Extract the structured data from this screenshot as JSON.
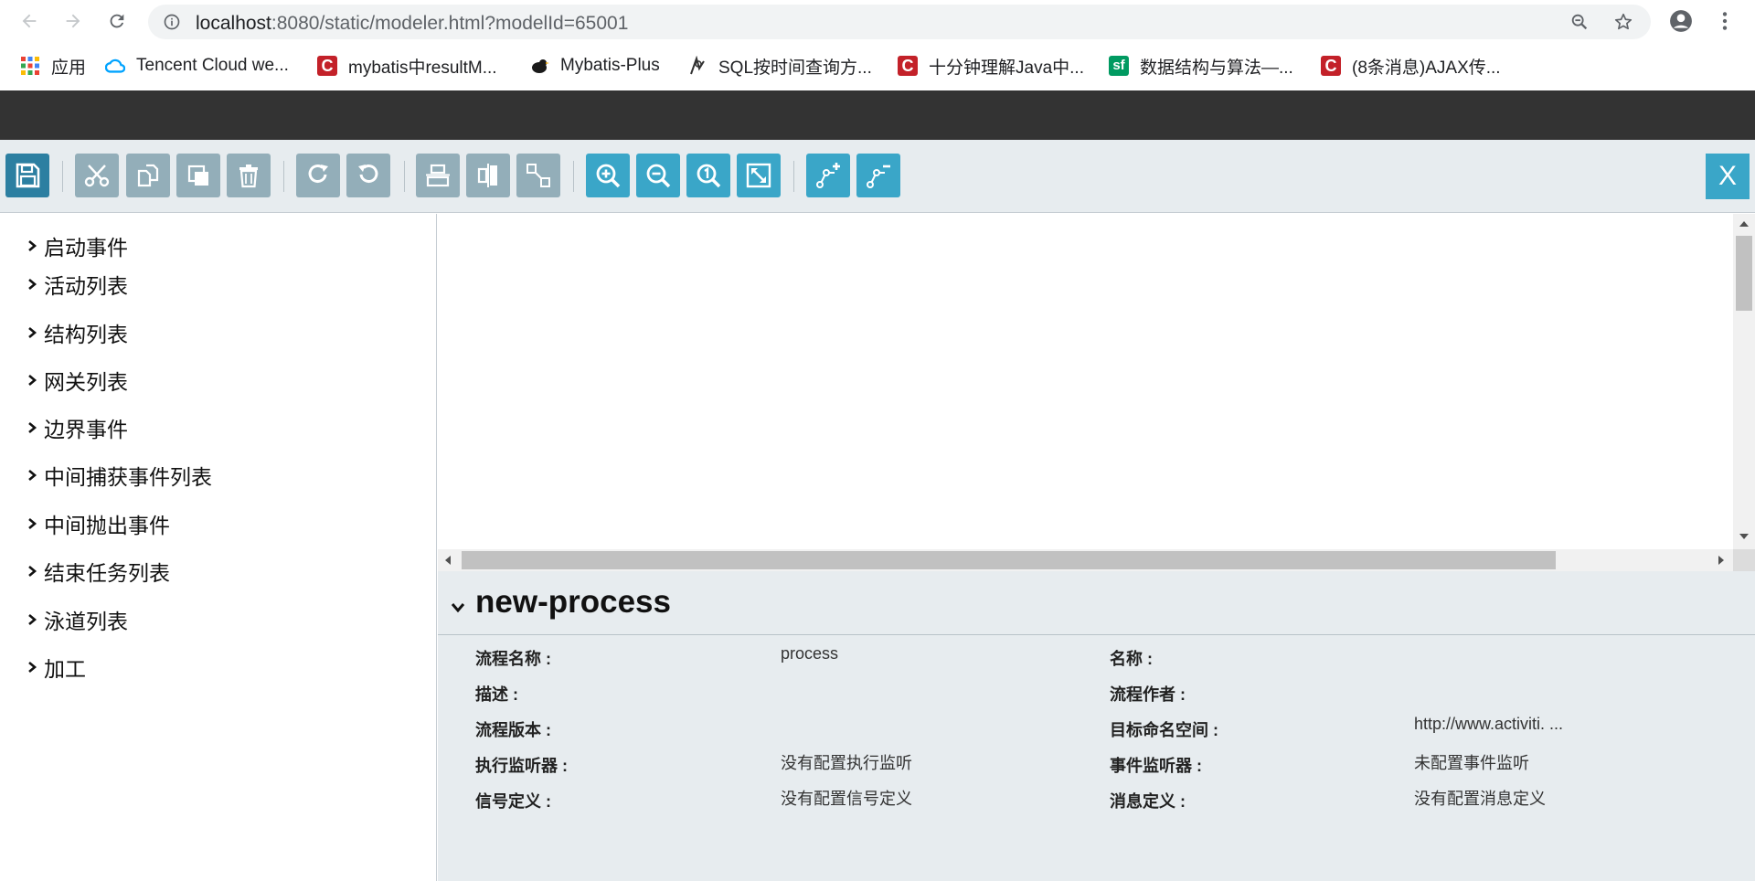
{
  "browser": {
    "url_host": "localhost",
    "url_rest": ":8080/static/modeler.html?modelId=65001"
  },
  "bookmarks": [
    {
      "label": "应用",
      "icon": "apps-grid-icon"
    },
    {
      "label": "Tencent Cloud we...",
      "icon": "tencent-cloud-icon"
    },
    {
      "label": "mybatis中resultM...",
      "icon": "csdn-icon"
    },
    {
      "label": "Mybatis-Plus",
      "icon": "mybatis-plus-bird-icon"
    },
    {
      "label": "SQL按时间查询方...",
      "icon": "sql-site-icon"
    },
    {
      "label": "十分钟理解Java中...",
      "icon": "csdn-icon"
    },
    {
      "label": "数据结构与算法—...",
      "icon": "segmentfault-icon"
    },
    {
      "label": "(8条消息)AJAX传...",
      "icon": "csdn-icon"
    }
  ],
  "toolbar": {
    "close_label": "X",
    "buttons": [
      {
        "name": "save-button",
        "icon": "save-icon"
      },
      {
        "name": "cut-button",
        "icon": "scissors-icon"
      },
      {
        "name": "copy-button",
        "icon": "copy-icon"
      },
      {
        "name": "paste-button",
        "icon": "paste-icon"
      },
      {
        "name": "delete-button",
        "icon": "trash-icon"
      },
      {
        "name": "redo-button",
        "icon": "redo-icon"
      },
      {
        "name": "undo-button",
        "icon": "undo-icon"
      },
      {
        "name": "align-horizontal-button",
        "icon": "align-horizontal-icon"
      },
      {
        "name": "align-vertical-button",
        "icon": "align-vertical-icon"
      },
      {
        "name": "same-size-button",
        "icon": "same-size-icon"
      },
      {
        "name": "zoom-in-button",
        "icon": "zoom-in-icon"
      },
      {
        "name": "zoom-out-button",
        "icon": "zoom-out-icon"
      },
      {
        "name": "zoom-actual-button",
        "icon": "zoom-actual-icon"
      },
      {
        "name": "zoom-fit-button",
        "icon": "zoom-fit-icon"
      },
      {
        "name": "add-bendpoint-button",
        "icon": "add-bendpoint-icon"
      },
      {
        "name": "remove-bendpoint-button",
        "icon": "remove-bendpoint-icon"
      }
    ]
  },
  "palette": {
    "items": [
      "启动事件",
      "活动列表",
      "结构列表",
      "网关列表",
      "边界事件",
      "中间捕获事件列表",
      "中间抛出事件",
      "结束任务列表",
      "泳道列表",
      "加工"
    ]
  },
  "properties": {
    "title": "new-process",
    "rows": [
      {
        "label": "流程名称 :",
        "value": "process",
        "label2": "名称 :",
        "value2": ""
      },
      {
        "label": "描述 :",
        "value": "",
        "label2": "流程作者 :",
        "value2": ""
      },
      {
        "label": "流程版本 :",
        "value": "",
        "label2": "目标命名空间 :",
        "value2": "http://www.activiti. ..."
      },
      {
        "label": "执行监听器 :",
        "value": "没有配置执行监听",
        "label2": "事件监听器 :",
        "value2": "未配置事件监听"
      },
      {
        "label": "信号定义 :",
        "value": "没有配置信号定义",
        "label2": "消息定义 :",
        "value2": "没有配置消息定义"
      }
    ]
  },
  "colors": {
    "toolbar_bg": "#e7ecef",
    "topbar_bg": "#333333",
    "button_blue": "#3aa6c8",
    "button_gray": "#93aeb9",
    "button_save": "#2c7fa1"
  }
}
